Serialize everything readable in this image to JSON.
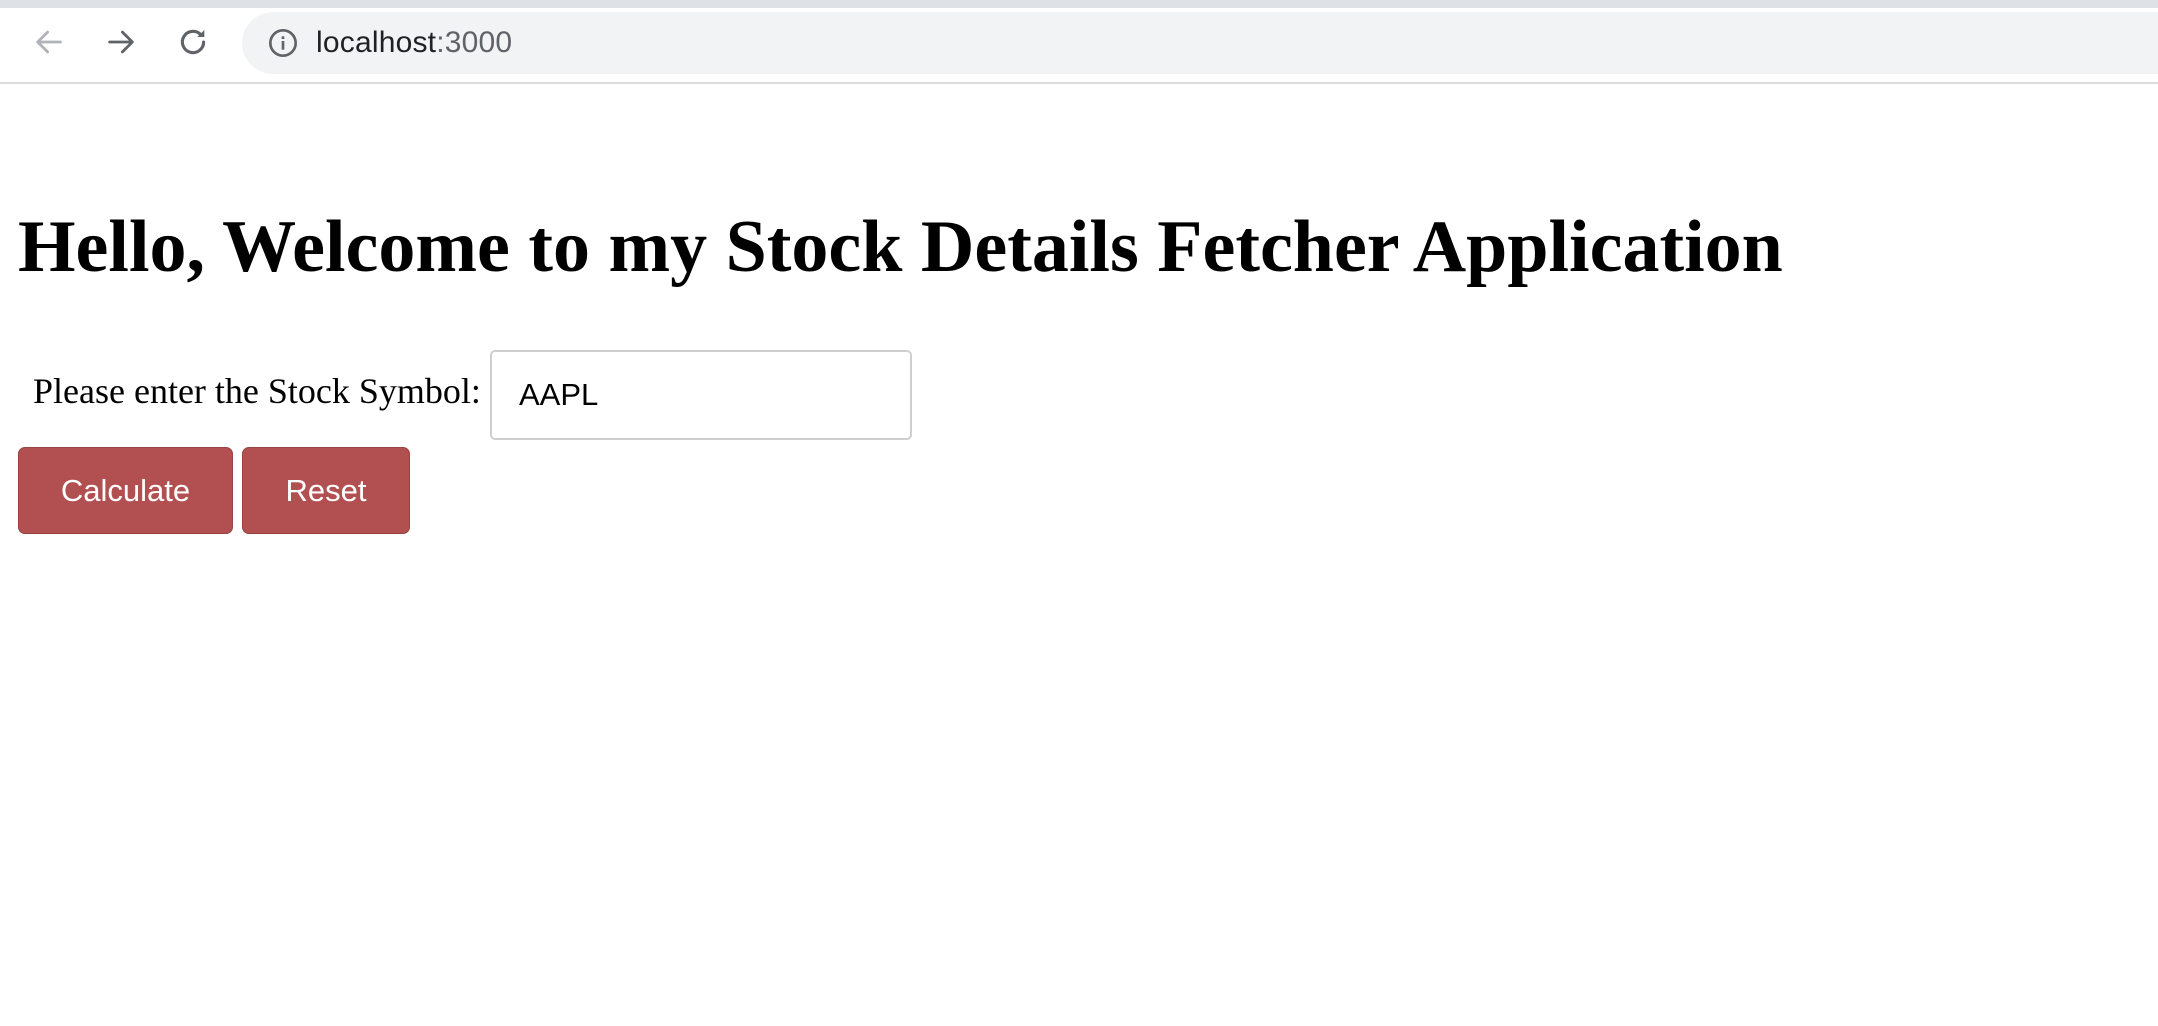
{
  "browser": {
    "url_host": "localhost",
    "url_port": ":3000",
    "back_icon": "arrow-left-icon",
    "forward_icon": "arrow-right-icon",
    "reload_icon": "reload-icon",
    "info_icon": "info-icon"
  },
  "page": {
    "title": "Hello, Welcome to my Stock Details Fetcher Application",
    "form": {
      "symbol_label": "Please enter the Stock Symbol:",
      "symbol_value": "AAPL",
      "calculate_label": "Calculate",
      "reset_label": "Reset"
    }
  },
  "colors": {
    "button_background": "#b24f50",
    "button_text": "#ffffff",
    "address_bar_background": "#f1f3f4"
  }
}
